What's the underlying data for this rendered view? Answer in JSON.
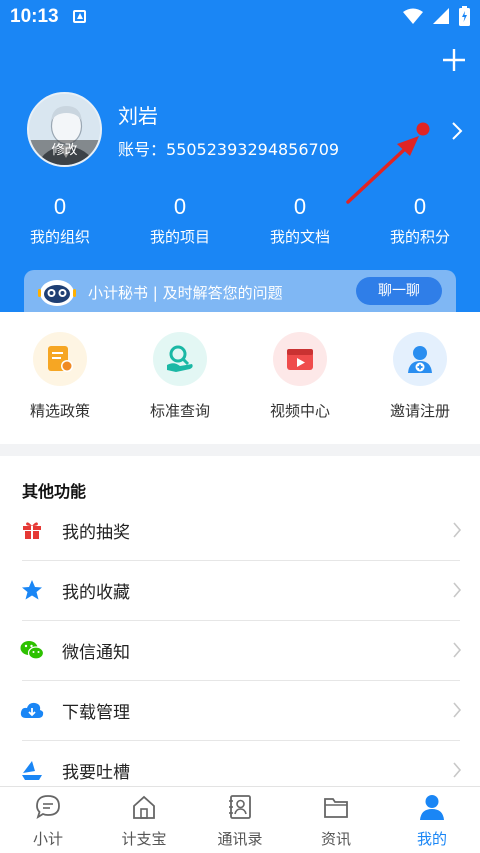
{
  "status_bar": {
    "time": "10:13"
  },
  "profile": {
    "avatar_edit_label": "修改",
    "name": "刘岩",
    "account_label": "账号：",
    "account_number": "55052393294856709"
  },
  "stats": [
    {
      "value": "0",
      "label": "我的组织"
    },
    {
      "value": "0",
      "label": "我的项目"
    },
    {
      "value": "0",
      "label": "我的文档"
    },
    {
      "value": "0",
      "label": "我的积分"
    }
  ],
  "assistant": {
    "text": "小计秘书 | 及时解答您的问题",
    "button_label": "聊一聊"
  },
  "quick_actions": [
    {
      "label": "精选政策",
      "icon": "policy-icon",
      "color": "#f6a623",
      "bg": "#fef5e3"
    },
    {
      "label": "标准查询",
      "icon": "standard-search-icon",
      "color": "#1bb8a5",
      "bg": "#e3f7f4"
    },
    {
      "label": "视频中心",
      "icon": "video-icon",
      "color": "#ef4c4c",
      "bg": "#fde8e8"
    },
    {
      "label": "邀请注册",
      "icon": "invite-user-icon",
      "color": "#2a8ef0",
      "bg": "#e4f0fd"
    }
  ],
  "other_functions": {
    "title": "其他功能",
    "items": [
      {
        "label": "我的抽奖",
        "icon": "gift-icon",
        "color": "#e53935"
      },
      {
        "label": "我的收藏",
        "icon": "star-icon",
        "color": "#1a86f5"
      },
      {
        "label": "微信通知",
        "icon": "wechat-icon",
        "color": "#2dc100"
      },
      {
        "label": "下载管理",
        "icon": "cloud-download-icon",
        "color": "#1a86f5"
      },
      {
        "label": "我要吐槽",
        "icon": "feedback-icon",
        "color": "#1a86f5"
      }
    ]
  },
  "bottom_nav": [
    {
      "label": "小计",
      "icon": "chat-bubble-icon",
      "active": false
    },
    {
      "label": "计支宝",
      "icon": "home-icon",
      "active": false
    },
    {
      "label": "通讯录",
      "icon": "contacts-icon",
      "active": false
    },
    {
      "label": "资讯",
      "icon": "folder-icon",
      "active": false
    },
    {
      "label": "我的",
      "icon": "person-icon",
      "active": true
    }
  ],
  "colors": {
    "primary": "#1a86f5",
    "annotation_red": "#e02424"
  }
}
